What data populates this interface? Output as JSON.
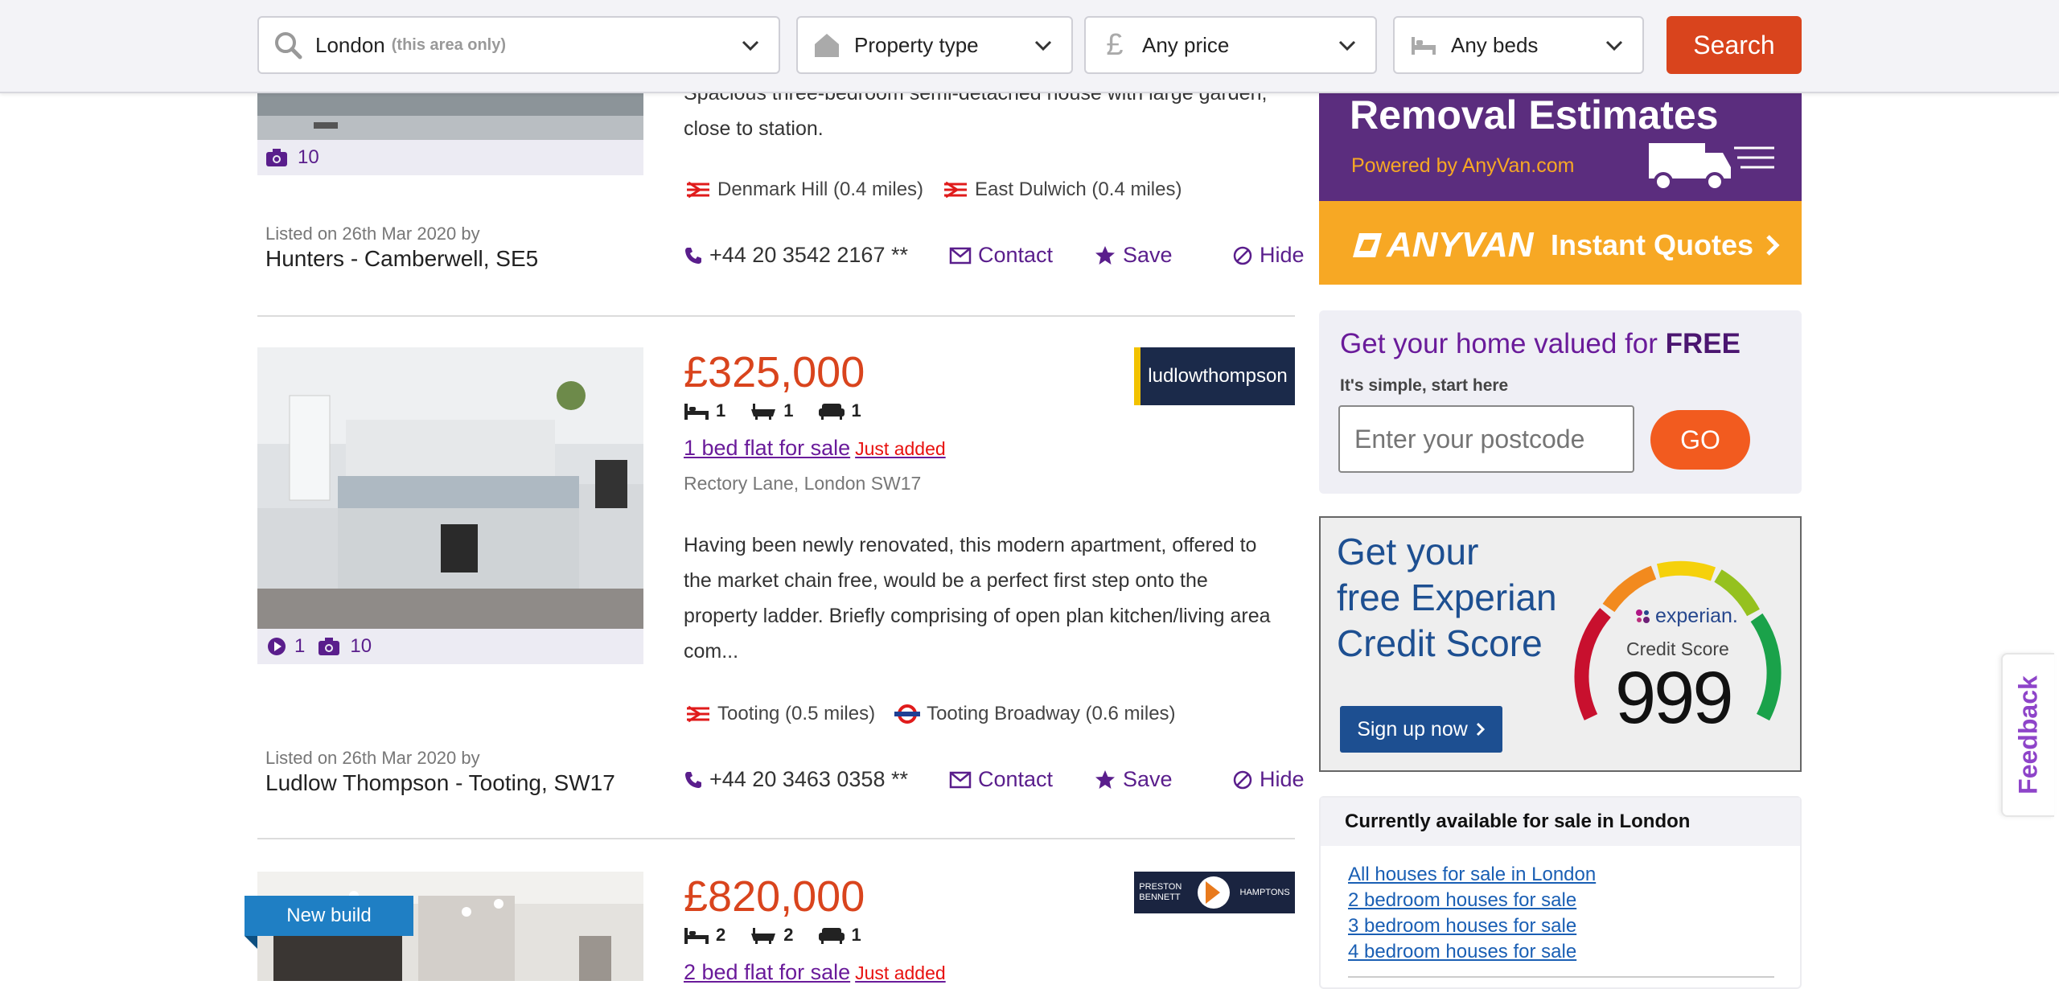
{
  "search": {
    "location_value": "London",
    "location_hint": "(this area only)",
    "property_type": "Property type",
    "price": "Any price",
    "beds": "Any beds",
    "button": "Search"
  },
  "listings": [
    {
      "photo_count": "10",
      "description": "Spacious three-bedroom semi-detached house with large garden, close to station.",
      "stations": [
        {
          "name": "Denmark Hill (0.4 miles)",
          "icon": "national-rail-icon"
        },
        {
          "name": "East Dulwich (0.4 miles)",
          "icon": "national-rail-icon"
        }
      ],
      "listed": "Listed on 26th Mar 2020 by",
      "agent": "Hunters - Camberwell, SE5",
      "phone": "+44 20 3542 2167 **",
      "contact": "Contact",
      "save": "Save",
      "hide": "Hide"
    },
    {
      "price": "£325,000",
      "beds": "1",
      "baths": "1",
      "receptions": "1",
      "title": "1 bed flat for sale",
      "badge": "Just added",
      "address": "Rectory Lane, London SW17",
      "agent_logo": "ludlowthompson",
      "video_count": "1",
      "photo_count": "10",
      "description_lines": [
        "Having been newly renovated, this modern apartment, offered to",
        "the market chain free, would be a perfect first step onto the",
        "property ladder. Briefly comprising of open plan kitchen/living area",
        "com..."
      ],
      "stations": [
        {
          "name": "Tooting (0.5 miles)",
          "icon": "national-rail-icon"
        },
        {
          "name": "Tooting Broadway (0.6 miles)",
          "icon": "underground-icon"
        }
      ],
      "listed": "Listed on 26th Mar 2020 by",
      "agent": "Ludlow Thompson - Tooting, SW17",
      "phone": "+44 20 3463 0358 **",
      "contact": "Contact",
      "save": "Save",
      "hide": "Hide"
    },
    {
      "price": "£820,000",
      "beds": "2",
      "baths": "2",
      "receptions": "1",
      "title": "2 bed flat for sale",
      "badge": "Just added",
      "ribbon": "New build",
      "agent_logo_left": "PRESTON BENNETT",
      "agent_logo_right": "HAMPTONS"
    }
  ],
  "sidebar": {
    "anyvan": {
      "headline": "Removal Estimates",
      "powered": "Powered by AnyVan.com",
      "brand": "ANYVAN",
      "cta": "Instant Quotes"
    },
    "valuation": {
      "title_prefix": "Get your home valued for ",
      "title_bold": "FREE",
      "subtitle": "It's simple, start here",
      "placeholder": "Enter your postcode",
      "button": "GO"
    },
    "experian": {
      "line1": "Get your",
      "line2": "free Experian",
      "line3": "Credit Score",
      "button": "Sign up now",
      "brand": "experian.",
      "gauge_label": "Credit Score",
      "score": "999"
    },
    "available": {
      "heading": "Currently available for sale in London",
      "links": [
        "All houses for sale in London",
        "2 bedroom houses for sale",
        "3 bedroom houses for sale",
        "4 bedroom houses for sale"
      ]
    }
  },
  "feedback": "Feedback",
  "colors": {
    "accent": "#d9441d",
    "purple": "#5a1e8c",
    "link": "#1a5fb4",
    "just_added": "#e8110f"
  }
}
